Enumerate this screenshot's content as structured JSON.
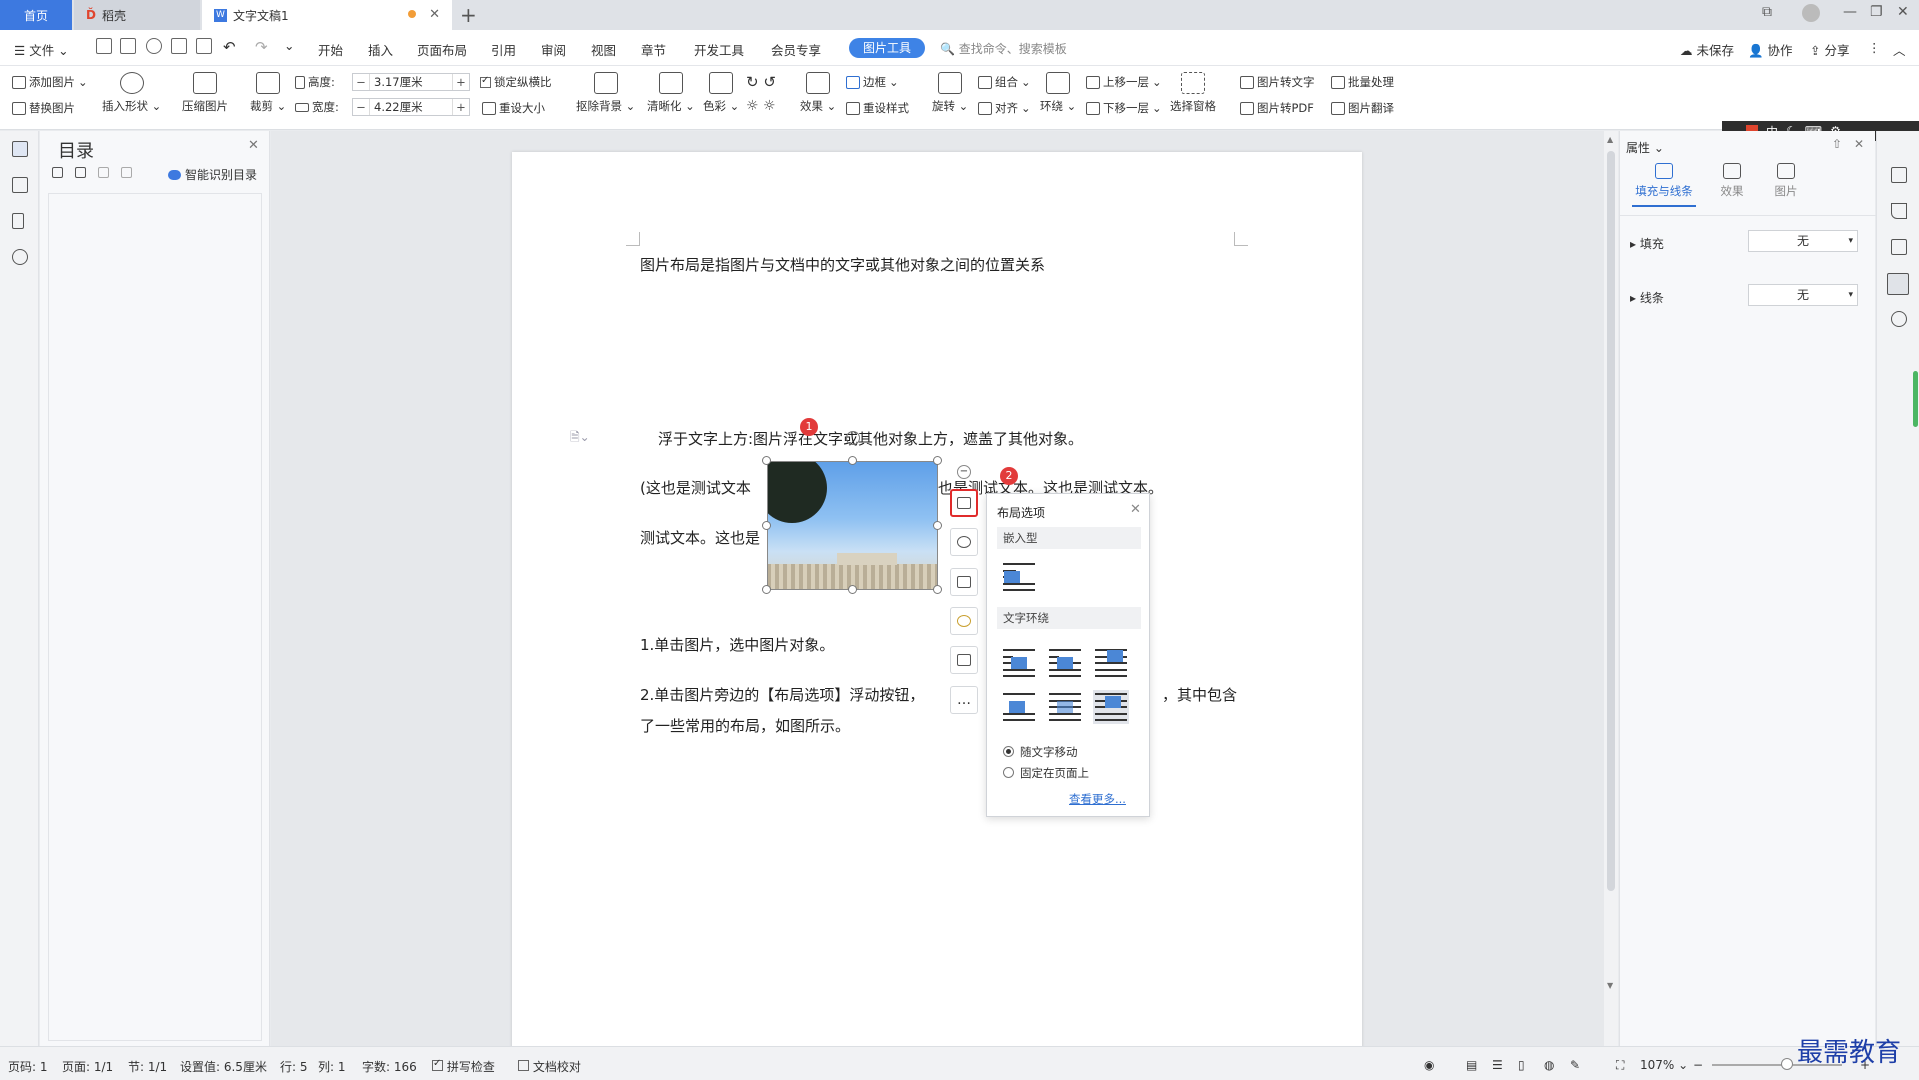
{
  "tabs": {
    "home": "首页",
    "daoke": "稻壳",
    "doc": "文字文稿1"
  },
  "menu": {
    "file": "文件",
    "items": [
      "开始",
      "插入",
      "页面布局",
      "引用",
      "审阅",
      "视图",
      "章节",
      "开发工具",
      "会员专享"
    ],
    "picture_tools": "图片工具",
    "search_placeholder": "查找命令、搜索模板",
    "unsaved": "未保存",
    "collab": "协作",
    "share": "分享"
  },
  "ribbon": {
    "add_picture": "添加图片",
    "replace_picture": "替换图片",
    "insert_shape": "插入形状",
    "compress": "压缩图片",
    "crop": "裁剪",
    "height_label": "高度:",
    "height_value": "3.17厘米",
    "width_label": "宽度:",
    "width_value": "4.22厘米",
    "lock_ratio": "锁定纵横比",
    "reset_size": "重设大小",
    "remove_bg": "抠除背景",
    "sharpen": "清晰化",
    "color": "色彩",
    "effect": "效果",
    "border": "边框",
    "reset_style": "重设样式",
    "rotate": "旋转",
    "group": "组合",
    "align": "对齐",
    "wrap": "环绕",
    "bring_forward": "上移一层",
    "send_backward": "下移一层",
    "select_pane": "选择窗格",
    "pic_to_text": "图片转文字",
    "pic_to_pdf": "图片转PDF",
    "batch": "批量处理",
    "translate": "图片翻译"
  },
  "toc": {
    "title": "目录",
    "smart": "智能识别目录"
  },
  "document": {
    "line1": "图片布局是指图片与文档中的文字或其他对象之间的位置关系",
    "line2": "浮于文字上方:图片浮在文字或其他对象上方，遮盖了其他对象。",
    "line3a": "(这也是测试文本",
    "line3b": "也是测试文本。这也是测试文本。",
    "line4": "测试文本。这也是",
    "line5": "1.单击图片，选中图片对象。",
    "line6a": "2.单击图片旁边的【布局选项】浮动按钮，",
    "line6b": "，其中包含",
    "line7": "了一些常用的布局，如图所示。",
    "badge1": "1",
    "badge2": "2"
  },
  "popup": {
    "title": "布局选项",
    "inline": "嵌入型",
    "wrap": "文字环绕",
    "move_with_text": "随文字移动",
    "fix_on_page": "固定在页面上",
    "more": "查看更多..."
  },
  "props": {
    "title": "属性",
    "tab_fill": "填充与线条",
    "tab_effect": "效果",
    "tab_pic": "图片",
    "fill": "填充",
    "fill_value": "无",
    "line": "线条",
    "line_value": "无"
  },
  "status": {
    "page": "页码: 1",
    "pages": "页面: 1/1",
    "section": "节: 1/1",
    "setting": "设置值: 6.5厘米",
    "row": "行: 5",
    "col": "列: 1",
    "words": "字数: 166",
    "spell": "拼写检查",
    "proof": "文档校对",
    "zoom": "107%"
  },
  "watermark": "最需教育",
  "ime": "中"
}
